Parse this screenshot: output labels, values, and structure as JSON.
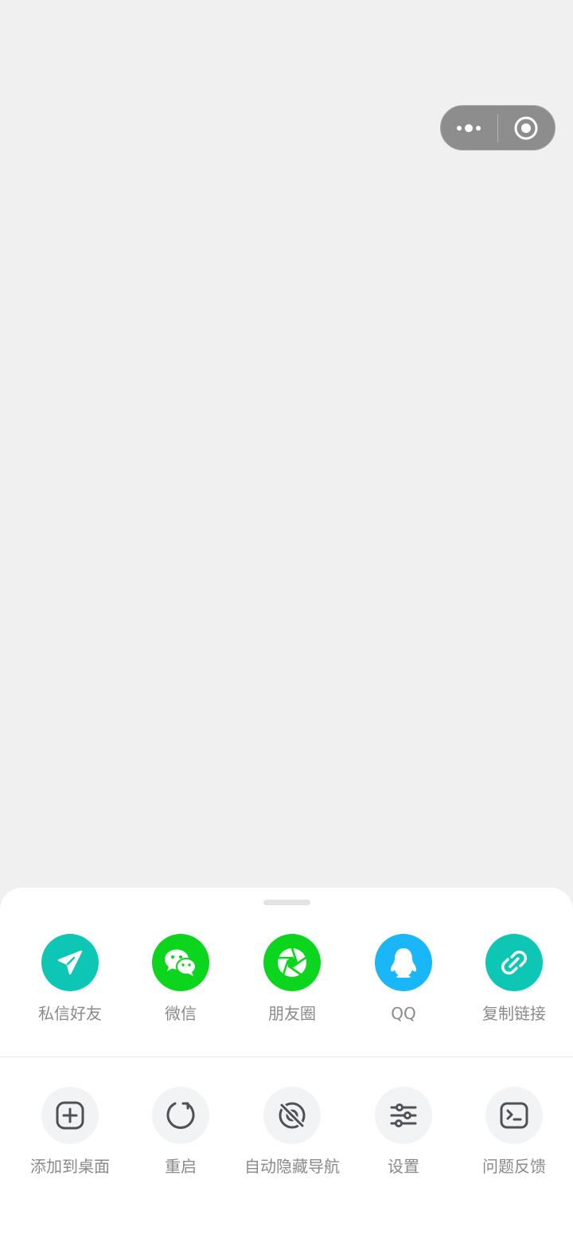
{
  "capsule": {
    "more_icon": "more-dots-icon",
    "close_icon": "record-target-icon"
  },
  "share_row": [
    {
      "label": "私信好友",
      "icon": "paper-plane-icon",
      "color": "#0dc7b4"
    },
    {
      "label": "微信",
      "icon": "wechat-icon",
      "color": "#0bd51c"
    },
    {
      "label": "朋友圈",
      "icon": "moments-aperture-icon",
      "color": "#0bd51c"
    },
    {
      "label": "QQ",
      "icon": "qq-penguin-icon",
      "color": "#1ab7f8"
    },
    {
      "label": "复制链接",
      "icon": "link-icon",
      "color": "#0dc7b4"
    }
  ],
  "action_row": [
    {
      "label": "添加到桌面",
      "icon": "add-square-icon"
    },
    {
      "label": "重启",
      "icon": "restart-icon"
    },
    {
      "label": "自动隐藏导航",
      "icon": "hide-eye-icon"
    },
    {
      "label": "设置",
      "icon": "sliders-icon"
    },
    {
      "label": "问题反馈",
      "icon": "terminal-icon"
    }
  ],
  "colors": {
    "background": "#f0f0f0",
    "sheet": "#ffffff",
    "label": "#8a8a8a",
    "action_icon": "#4e5158"
  }
}
